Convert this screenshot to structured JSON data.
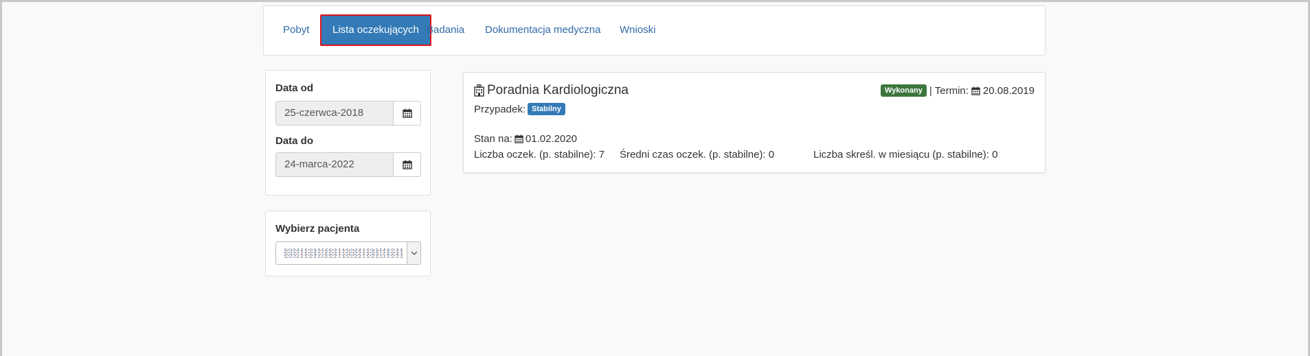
{
  "tabs": [
    {
      "label": "Pobyt",
      "active": false
    },
    {
      "label": "Lista oczekujących",
      "active": true
    },
    {
      "label": "Badania",
      "active": false
    },
    {
      "label": "Dokumentacja medyczna",
      "active": false
    },
    {
      "label": "Wnioski",
      "active": false
    }
  ],
  "filters": {
    "date_from_label": "Data od",
    "date_from_value": "25-czerwca-2018",
    "date_to_label": "Data do",
    "date_to_value": "24-marca-2022"
  },
  "patient": {
    "label": "Wybierz pacjenta"
  },
  "card": {
    "title": "Poradnia Kardiologiczna",
    "status_badge": "Wykonany",
    "separator": "|",
    "term_label": "Termin:",
    "term_date": "20.08.2019",
    "case_label": "Przypadek:",
    "case_badge": "Stabilny",
    "state_label": "Stan na:",
    "state_date": "01.02.2020",
    "stat_waiting": "Liczba oczek. (p. stabilne): 7",
    "stat_avg_time": "Średni czas oczek. (p. stabilne): 0",
    "stat_removed": "Liczba skreśl. w miesiącu (p. stabilne): 0"
  },
  "colors": {
    "accent": "#337ab7",
    "link": "#2f6aa8",
    "success": "#3c763d",
    "highlight_border": "#e0141a"
  }
}
